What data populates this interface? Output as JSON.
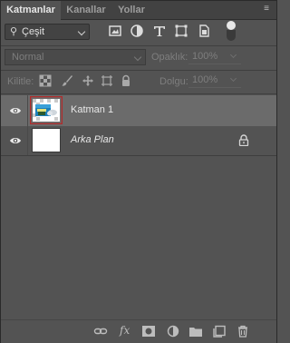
{
  "tabs": [
    {
      "label": "Katmanlar",
      "active": true
    },
    {
      "label": "Kanallar",
      "active": false
    },
    {
      "label": "Yollar",
      "active": false
    }
  ],
  "filter": {
    "kind_label": "Çeşit",
    "icons": [
      "pixel-filter-icon",
      "adjustment-filter-icon",
      "type-filter-icon",
      "shape-filter-icon",
      "smart-object-filter-icon"
    ]
  },
  "blend": {
    "mode": "Normal",
    "opacity_label": "Opaklık:",
    "opacity_value": "100%"
  },
  "locks": {
    "label": "Kilitle:",
    "fill_label": "Dolgu:",
    "fill_value": "100%"
  },
  "layers": [
    {
      "name": "Katman 1",
      "selected": true,
      "visible": true,
      "locked": false
    },
    {
      "name": "Arka Plan",
      "selected": false,
      "visible": true,
      "locked": true
    }
  ],
  "footer_icons": [
    "link-layers-icon",
    "fx-icon",
    "mask-icon",
    "adjustment-layer-icon",
    "group-folder-icon",
    "new-layer-icon",
    "trash-icon"
  ],
  "colors": {
    "panel_bg": "#535353",
    "selected_layer_bg": "#6b6b6b",
    "thumb_selection_border": "#b02b2b"
  }
}
